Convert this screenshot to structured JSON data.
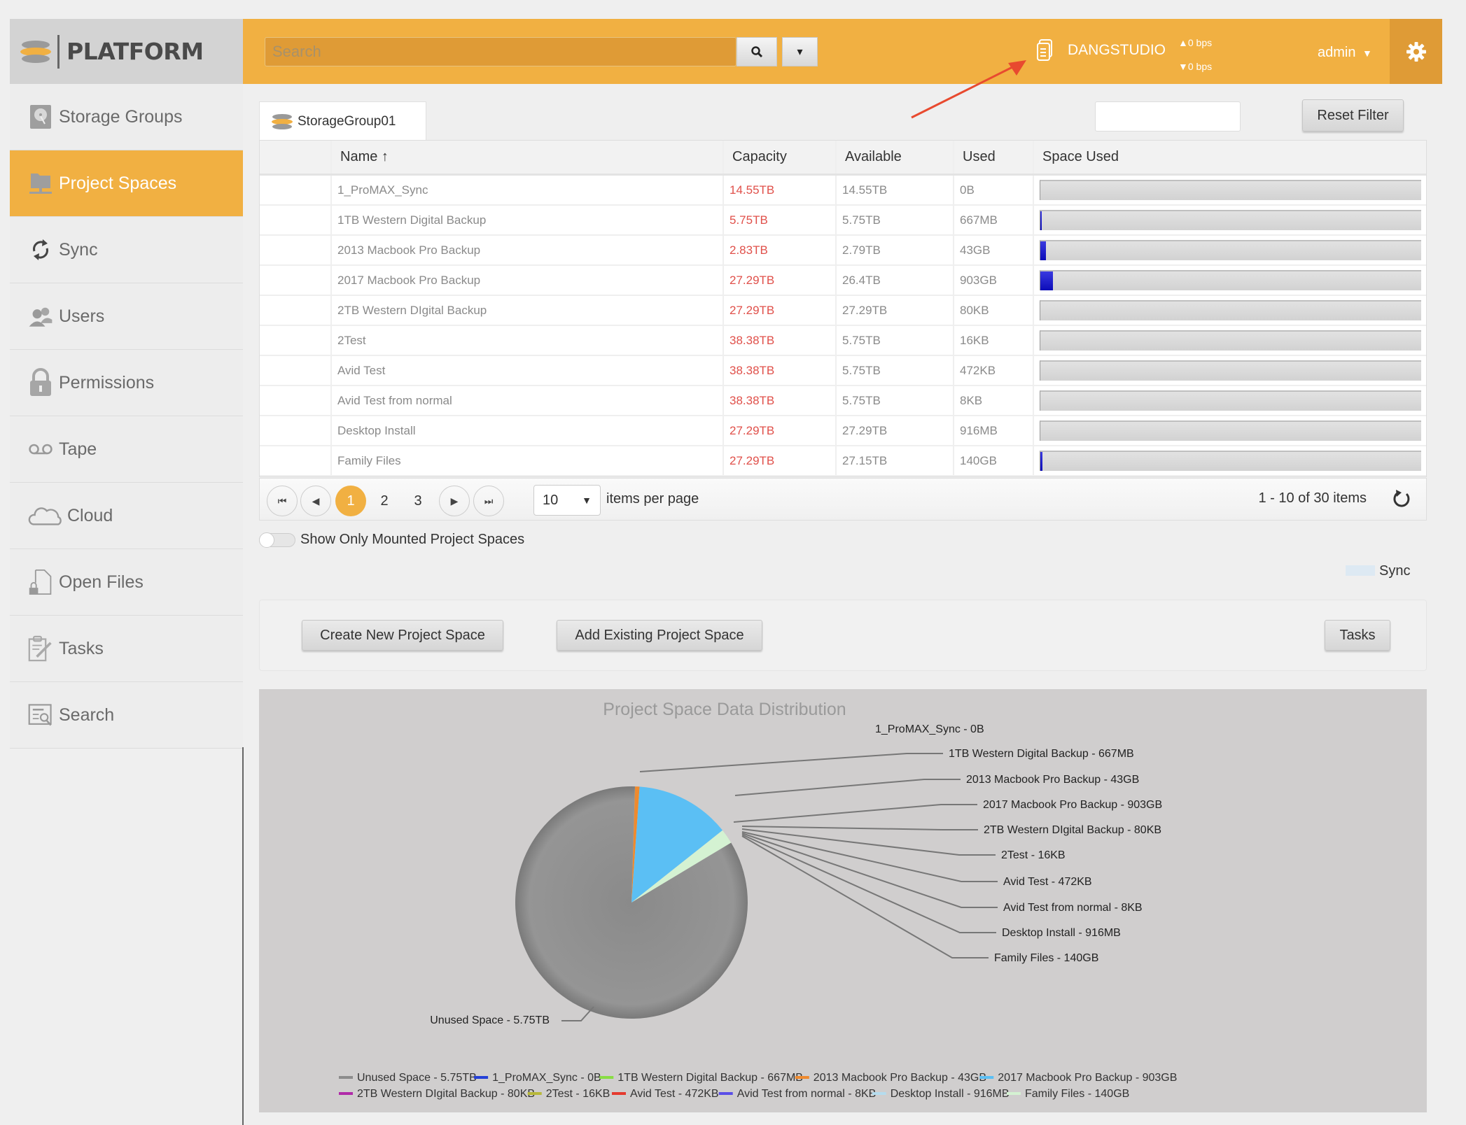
{
  "app": {
    "logo_text": "PLATFORM",
    "search_placeholder": "Search",
    "server_name": "DANGSTUDIO",
    "bps_up": "▲0 bps",
    "bps_down": "▼0 bps",
    "user": "admin",
    "accent_color": "#f1b042"
  },
  "sidebar": {
    "items": [
      {
        "label": "Storage Groups",
        "icon": "hard-drive-icon",
        "active": false
      },
      {
        "label": "Project Spaces",
        "icon": "network-folder-icon",
        "active": true
      },
      {
        "label": "Sync",
        "icon": "sync-icon",
        "active": false
      },
      {
        "label": "Users",
        "icon": "users-icon",
        "active": false
      },
      {
        "label": "Permissions",
        "icon": "lock-icon",
        "active": false
      },
      {
        "label": "Tape",
        "icon": "tape-icon",
        "active": false
      },
      {
        "label": "Cloud",
        "icon": "cloud-icon",
        "active": false
      },
      {
        "label": "Open Files",
        "icon": "locked-file-icon",
        "active": false
      },
      {
        "label": "Tasks",
        "icon": "clipboard-edit-icon",
        "active": false
      },
      {
        "label": "Search",
        "icon": "search-document-icon",
        "active": false
      }
    ]
  },
  "main": {
    "tab_label": "StorageGroup01",
    "filter_value": "",
    "reset_filter_label": "Reset Filter",
    "table": {
      "columns": [
        "",
        "Name ↑",
        "Capacity",
        "Available",
        "Used",
        "Space Used"
      ],
      "rows": [
        {
          "name": "1_ProMAX_Sync",
          "capacity": "14.55TB",
          "available": "14.55TB",
          "used": "0B",
          "space_used_pct": 0
        },
        {
          "name": "1TB Western Digital Backup",
          "capacity": "5.75TB",
          "available": "5.75TB",
          "used": "667MB",
          "space_used_pct": 0.01
        },
        {
          "name": "2013 Macbook Pro Backup",
          "capacity": "2.83TB",
          "available": "2.79TB",
          "used": "43GB",
          "space_used_pct": 1.5
        },
        {
          "name": "2017 Macbook Pro Backup",
          "capacity": "27.29TB",
          "available": "26.4TB",
          "used": "903GB",
          "space_used_pct": 3.3
        },
        {
          "name": "2TB Western DIgital Backup",
          "capacity": "27.29TB",
          "available": "27.29TB",
          "used": "80KB",
          "space_used_pct": 0
        },
        {
          "name": "2Test",
          "capacity": "38.38TB",
          "available": "5.75TB",
          "used": "16KB",
          "space_used_pct": 0
        },
        {
          "name": "Avid Test",
          "capacity": "38.38TB",
          "available": "5.75TB",
          "used": "472KB",
          "space_used_pct": 0
        },
        {
          "name": "Avid Test from normal",
          "capacity": "38.38TB",
          "available": "5.75TB",
          "used": "8KB",
          "space_used_pct": 0
        },
        {
          "name": "Desktop Install",
          "capacity": "27.29TB",
          "available": "27.29TB",
          "used": "916MB",
          "space_used_pct": 0
        },
        {
          "name": "Family Files",
          "capacity": "27.29TB",
          "available": "27.15TB",
          "used": "140GB",
          "space_used_pct": 0.5
        }
      ]
    },
    "pager": {
      "pages": [
        "1",
        "2",
        "3"
      ],
      "current_page": "1",
      "per_page": "10",
      "per_page_label": "items per page",
      "items_count": "1 - 10 of 30 items"
    },
    "toggle_label": "Show Only Mounted Project Spaces",
    "toggle_on": false,
    "sync_legend_label": "Sync",
    "sync_legend_color": "#dde9f3",
    "buttons": {
      "create": "Create New Project Space",
      "add_existing": "Add Existing Project Space",
      "tasks": "Tasks"
    }
  },
  "chart_data": {
    "type": "pie",
    "title": "Project Space Data Distribution",
    "unit_note": "slice sizes estimated from rendered pie",
    "slices": [
      {
        "label": "Unused Space - 5.75TB",
        "name": "Unused Space",
        "value": 5750,
        "unit": "GB",
        "color": "#8c8c8c"
      },
      {
        "label": "1_ProMAX_Sync - 0B",
        "name": "1_ProMAX_Sync",
        "value": 0,
        "unit": "GB",
        "color": "#2440d8"
      },
      {
        "label": "1TB Western Digital Backup - 667MB",
        "name": "1TB Western Digital Backup",
        "value": 0.667,
        "unit": "GB",
        "color": "#88dd44"
      },
      {
        "label": "2013 Macbook Pro Backup - 43GB",
        "name": "2013 Macbook Pro Backup",
        "value": 43,
        "unit": "GB",
        "color": "#ef8a2e"
      },
      {
        "label": "2017 Macbook Pro Backup - 903GB",
        "name": "2017 Macbook Pro Backup",
        "value": 903,
        "unit": "GB",
        "color": "#5bbff4"
      },
      {
        "label": "2TB Western DIgital Backup - 80KB",
        "name": "2TB Western DIgital Backup",
        "value": 8e-05,
        "unit": "GB",
        "color": "#b02aa8"
      },
      {
        "label": "2Test - 16KB",
        "name": "2Test",
        "value": 1.6e-05,
        "unit": "GB",
        "color": "#b8b83a"
      },
      {
        "label": "Avid Test - 472KB",
        "name": "Avid Test",
        "value": 0.000472,
        "unit": "GB",
        "color": "#e53a2e"
      },
      {
        "label": "Avid Test from normal - 8KB",
        "name": "Avid Test from normal",
        "value": 8e-06,
        "unit": "GB",
        "color": "#5a4ee8"
      },
      {
        "label": "Desktop Install - 916MB",
        "name": "Desktop Install",
        "value": 0.916,
        "unit": "GB",
        "color": "#b5dcee"
      },
      {
        "label": "Family Files - 140GB",
        "name": "Family Files",
        "value": 140,
        "unit": "GB",
        "color": "#d4f2d2"
      }
    ],
    "legend_position": "bottom"
  }
}
